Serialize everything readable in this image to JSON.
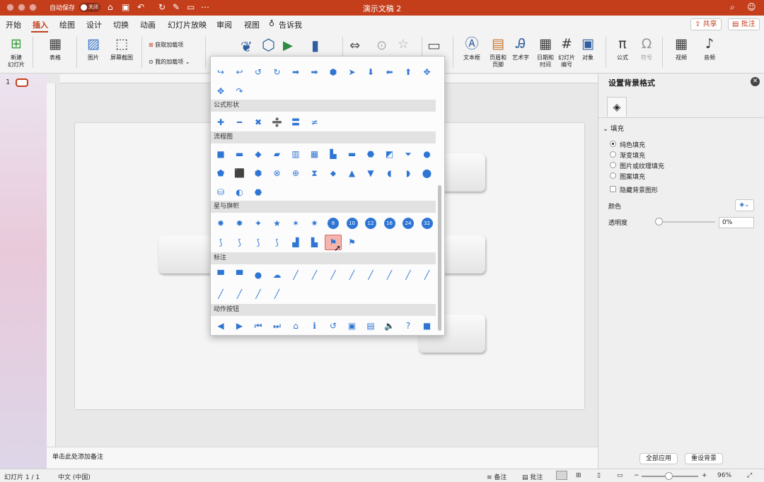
{
  "titlebar": {
    "autosave_label": "自动保存",
    "toggle_state": "关闭",
    "doc_title": "演示文稿 2"
  },
  "tabs": [
    "开始",
    "插入",
    "绘图",
    "设计",
    "切换",
    "动画",
    "幻灯片放映",
    "审阅",
    "视图"
  ],
  "tell_me": "告诉我",
  "share_label": "共享",
  "comments_label": "批注",
  "ribbon": {
    "new_slide": "新建\n幻灯片",
    "table": "表格",
    "pictures": "图片",
    "screenshot": "屏幕截图",
    "get_addins": "获取加载项",
    "my_addins": "我的加载项",
    "textbox": "文本框",
    "header_footer": "页眉和\n页脚",
    "wordart": "艺术字",
    "date_time": "日期和\n时间",
    "slide_number": "幻灯片\n编号",
    "object": "对象",
    "equation": "公式",
    "symbol": "符号",
    "video": "视频",
    "audio": "音频"
  },
  "slide_list": {
    "number": "1"
  },
  "notes_placeholder": "单击此处添加备注",
  "shapes_menu": {
    "sections": [
      {
        "title": "",
        "shapes": [
          "↪",
          "↩",
          "↺",
          "↻",
          "➡",
          "➡",
          "⬢",
          "➤",
          "⬇",
          "⬅",
          "⬆",
          "✥",
          "✥",
          "↷"
        ]
      },
      {
        "title": "公式形状",
        "shapes": [
          "✚",
          "━",
          "✖",
          "➗",
          "〓",
          "≠"
        ]
      },
      {
        "title": "流程图",
        "shapes": [
          "■",
          "▬",
          "◆",
          "▰",
          "▥",
          "▦",
          "▙",
          "▬",
          "⬣",
          "◩",
          "⏷",
          "●",
          "⬟",
          "⬛",
          "⬢",
          "⊗",
          "⊕",
          "⧗",
          "⬥",
          "▲",
          "▼",
          "◖",
          "◗",
          "⬤",
          "⛁",
          "◐",
          "⬣"
        ]
      },
      {
        "title": "星与旗帜",
        "shapes": [
          "✸",
          "✹",
          "✦",
          "★",
          "✶",
          "✷",
          "8",
          "10",
          "12",
          "16",
          "24",
          "32",
          "⟆",
          "⟆",
          "⟆",
          "⟆",
          "▟",
          "▙",
          "⚑",
          "⚑"
        ]
      },
      {
        "title": "标注",
        "shapes": [
          "▀",
          "▀",
          "●",
          "☁",
          "╱",
          "╱",
          "╱",
          "╱",
          "╱",
          "╱",
          "╱",
          "╱",
          "╱",
          "╱",
          "╱",
          "╱"
        ]
      },
      {
        "title": "动作按钮",
        "shapes": [
          "◀",
          "▶",
          "⏮",
          "⏭",
          "⌂",
          "ℹ",
          "↺",
          "▣",
          "▤",
          "🔈",
          "?",
          "■"
        ]
      }
    ]
  },
  "panel": {
    "title": "设置背景格式",
    "fill_section": "填充",
    "options": [
      "纯色填充",
      "渐变填充",
      "图片或纹理填充",
      "图案填充"
    ],
    "hide_bg": "隐藏背景图形",
    "color_label": "颜色",
    "transparency_label": "透明度",
    "transparency_value": "0%",
    "apply_all": "全部应用",
    "reset_bg": "重设背景"
  },
  "status": {
    "slide_info": "幻灯片 1 / 1",
    "language": "中文 (中国)",
    "notes": "备注",
    "comments": "批注",
    "zoom": "96%"
  }
}
